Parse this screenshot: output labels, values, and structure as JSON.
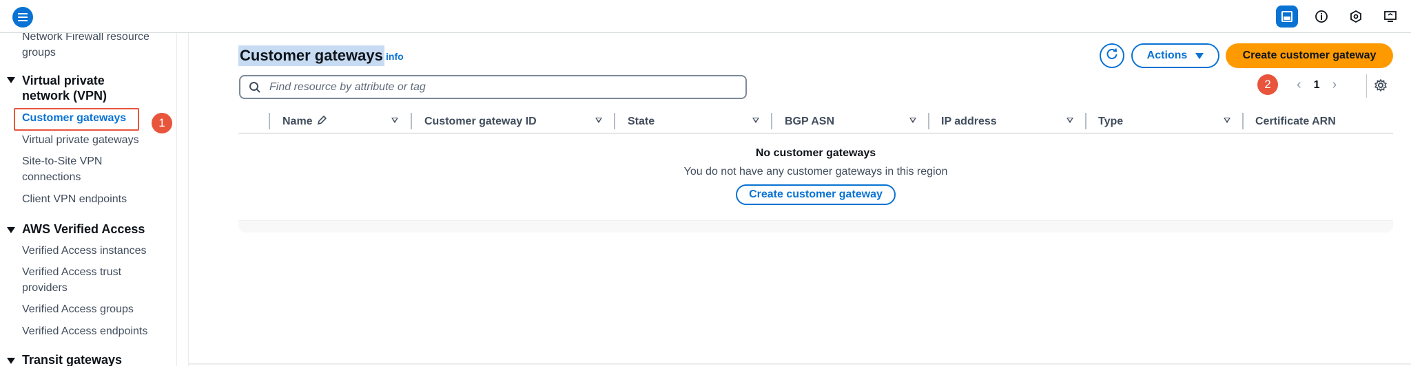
{
  "sidebar": {
    "top_item": "Network Firewall resource groups",
    "sections": [
      {
        "heading": "Virtual private network (VPN)",
        "items": [
          "Customer gateways",
          "Virtual private gateways",
          "Site-to-Site VPN connections",
          "Client VPN endpoints"
        ]
      },
      {
        "heading": "AWS Verified Access",
        "items": [
          "Verified Access instances",
          "Verified Access trust providers",
          "Verified Access groups",
          "Verified Access endpoints"
        ]
      },
      {
        "heading": "Transit gateways",
        "items": []
      }
    ],
    "active_item": "Customer gateways"
  },
  "annotations": {
    "badge1": "1",
    "badge2": "2"
  },
  "header": {
    "title": "Customer gateways",
    "info_link": "info",
    "search_placeholder": "Find resource by attribute or tag",
    "refresh_icon": "refresh-icon",
    "actions_label": "Actions",
    "create_label": "Create customer gateway"
  },
  "pagination": {
    "current_page": "1"
  },
  "table": {
    "columns": [
      "Name",
      "Customer gateway ID",
      "State",
      "BGP ASN",
      "IP address",
      "Type",
      "Certificate ARN"
    ],
    "empty_title": "No customer gateways",
    "empty_message": "You do not have any customer gateways in this region",
    "empty_action": "Create customer gateway"
  },
  "colors": {
    "accent": "#0972d3",
    "primary_button": "#ff9900",
    "annotation": "#e8553c"
  }
}
